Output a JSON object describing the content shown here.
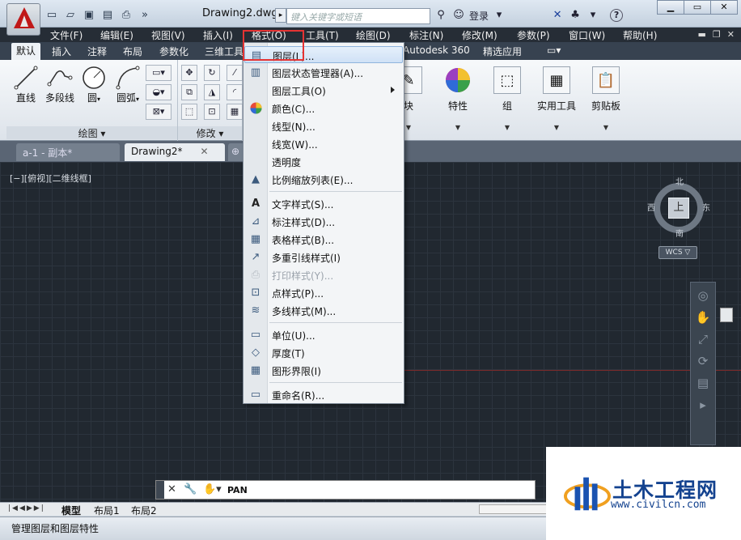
{
  "window": {
    "doc_title": "Drawing2.dwg",
    "search_placeholder": "键入关键字或短语",
    "signin_label": "登录",
    "help_icon": "?"
  },
  "menubar": {
    "items": [
      "文件(F)",
      "编辑(E)",
      "视图(V)",
      "插入(I)",
      "格式(O)",
      "工具(T)",
      "绘图(D)",
      "标注(N)",
      "修改(M)",
      "参数(P)",
      "窗口(W)",
      "帮助(H)"
    ]
  },
  "ribbon_tabs": {
    "items": [
      "默认",
      "插入",
      "注释",
      "布局",
      "参数化",
      "三维工具",
      "Autodesk 360",
      "精选应用"
    ],
    "active": "默认"
  },
  "ribbon": {
    "draw_tools": [
      "直线",
      "多段线",
      "圆",
      "圆弧"
    ],
    "draw_panel_title": "绘图",
    "modify_panel_title": "修改",
    "right_panels": [
      "块",
      "特性",
      "组",
      "实用工具",
      "剪贴板"
    ]
  },
  "doc_tabs": [
    {
      "label": "a-1 - 副本*",
      "active": false
    },
    {
      "label": "Drawing2*",
      "active": true
    }
  ],
  "viewport": {
    "label": "[−][俯视][二维线框]",
    "compass": {
      "north": "北",
      "south": "南",
      "east": "东",
      "west": "西",
      "top": "上"
    },
    "wcs": "WCS ▽"
  },
  "command_line": {
    "text": "PAN"
  },
  "layout_tabs": [
    "模型",
    "布局1",
    "布局2"
  ],
  "status": {
    "text": "管理图层和图层特性"
  },
  "format_menu": {
    "items": [
      {
        "label": "图层(L)...",
        "icon": "layer-icon",
        "state": "hover"
      },
      {
        "label": "图层状态管理器(A)...",
        "icon": "layer-state-icon"
      },
      {
        "label": "图层工具(O)",
        "icon": "",
        "submenu": true
      },
      {
        "label": "颜色(C)...",
        "icon": "color-wheel-icon"
      },
      {
        "label": "线型(N)...",
        "icon": ""
      },
      {
        "label": "线宽(W)...",
        "icon": ""
      },
      {
        "label": "透明度",
        "icon": ""
      },
      {
        "label": "比例缩放列表(E)...",
        "icon": "scale-list-icon"
      },
      {
        "label": "文字样式(S)...",
        "icon": "text-style-icon"
      },
      {
        "label": "标注样式(D)...",
        "icon": "dim-style-icon"
      },
      {
        "label": "表格样式(B)...",
        "icon": "table-style-icon"
      },
      {
        "label": "多重引线样式(I)",
        "icon": "mleader-style-icon"
      },
      {
        "label": "打印样式(Y)...",
        "icon": "plot-style-icon",
        "state": "disabled"
      },
      {
        "label": "点样式(P)...",
        "icon": "point-style-icon"
      },
      {
        "label": "多线样式(M)...",
        "icon": "mline-style-icon"
      },
      {
        "label": "单位(U)...",
        "icon": "units-icon"
      },
      {
        "label": "厚度(T)",
        "icon": "thickness-icon"
      },
      {
        "label": "图形界限(I)",
        "icon": "limits-icon"
      },
      {
        "label": "重命名(R)...",
        "icon": "rename-icon"
      }
    ]
  },
  "watermark": {
    "title": "土木工程网",
    "url": "www.civilcn.com"
  }
}
